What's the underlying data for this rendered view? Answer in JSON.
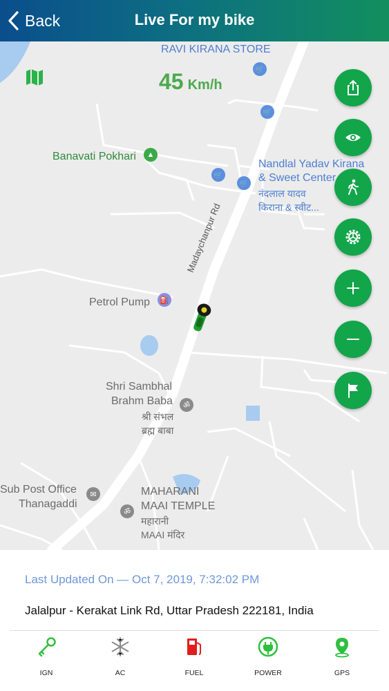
{
  "header": {
    "back_label": "Back",
    "title": "Live For my bike"
  },
  "map": {
    "speed_value": "45",
    "speed_unit": "Km/h",
    "places": {
      "ravi_kirana": "RAVI KIRANA STORE",
      "banavati": "Banavati Pokhari",
      "nandlal_1": "Nandlal Yadav Kirana",
      "nandlal_2": "& Sweet Center",
      "nandlal_hi_1": "नंदलाल यादव",
      "nandlal_hi_2": "किराना & स्वीट...",
      "road": "Madaychanpur Rd",
      "petrol": "Petrol Pump",
      "shri_1": "Shri Sambhal",
      "shri_2": "Brahm Baba",
      "shri_hi_1": "श्री संभल",
      "shri_hi_2": "ब्रह्म बाबा",
      "post_1": "Sub Post Office",
      "post_2": "Thanagaddi",
      "maharani_1": "MAHARANI",
      "maharani_2": "MAAI TEMPLE",
      "maharani_hi_1": "महारानी",
      "maharani_hi_2": "MAAI मंदिर"
    }
  },
  "info": {
    "last_updated": "Last Updated On — Oct 7, 2019, 7:32:02 PM",
    "address": "Jalalpur - Kerakat Link Rd, Uttar Pradesh 222181, India"
  },
  "status": [
    {
      "label": "IGN",
      "icon": "key-icon",
      "color": "#2fbf3f"
    },
    {
      "label": "AC",
      "icon": "snowflake-icon",
      "color": "#8a8a8a"
    },
    {
      "label": "FUEL",
      "icon": "fuel-icon",
      "color": "#e01e1e"
    },
    {
      "label": "POWER",
      "icon": "power-plug-icon",
      "color": "#2fbf3f"
    },
    {
      "label": "GPS",
      "icon": "gps-icon",
      "color": "#2fbf3f"
    }
  ],
  "colors": {
    "accent_green": "#12a54a",
    "header_start": "#0a4e8c",
    "header_end": "#128f5e",
    "poi_blue": "#5b8fe0"
  }
}
